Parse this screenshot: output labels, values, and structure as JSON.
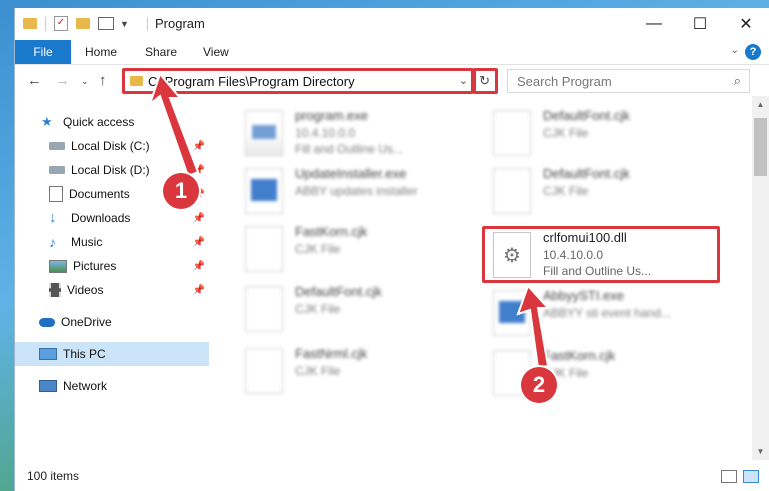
{
  "window": {
    "title": "Program",
    "controls": {
      "minimize": "—",
      "maximize": "☐",
      "close": "✕"
    }
  },
  "ribbon": {
    "file": "File",
    "tabs": [
      "Home",
      "Share",
      "View"
    ],
    "help": "?"
  },
  "nav": {
    "address": "C:\\Program Files\\Program Directory",
    "search_placeholder": "Search Program"
  },
  "sidebar": {
    "items": [
      {
        "label": "Quick access",
        "icon": "star-icon",
        "pinned": false
      },
      {
        "label": "Local Disk (C:)",
        "icon": "drive-icon",
        "pinned": true
      },
      {
        "label": "Local Disk (D:)",
        "icon": "drive-icon",
        "pinned": true
      },
      {
        "label": "Documents",
        "icon": "documents-icon",
        "pinned": true
      },
      {
        "label": "Downloads",
        "icon": "download-arrow-icon",
        "pinned": true
      },
      {
        "label": "Music",
        "icon": "music-note-icon",
        "pinned": true
      },
      {
        "label": "Pictures",
        "icon": "pictures-icon",
        "pinned": true
      },
      {
        "label": "Videos",
        "icon": "film-strip-icon",
        "pinned": true
      },
      {
        "label": "OneDrive",
        "icon": "cloud-icon",
        "pinned": false
      },
      {
        "label": "This PC",
        "icon": "monitor-icon",
        "pinned": false,
        "selected": true
      },
      {
        "label": "Network",
        "icon": "network-icon",
        "pinned": false
      }
    ]
  },
  "files": [
    {
      "name": "program.exe",
      "line1": "10.4.10.0.0",
      "line2": "Fill and Outline Us...",
      "icon": "installer-icon",
      "blurred": true
    },
    {
      "name": "DefaultFont.cjk",
      "line1": "CJK File",
      "line2": "",
      "icon": "blank-file-icon",
      "blurred": true
    },
    {
      "name": "UpdateInstaller.exe",
      "line1": "ABBY updates installer",
      "line2": "",
      "icon": "app-window-icon",
      "blurred": true
    },
    {
      "name": "DefaultFont.cjk",
      "line1": "CJK File",
      "line2": "",
      "icon": "blank-file-icon",
      "blurred": true
    },
    {
      "name": "FastKorn.cjk",
      "line1": "CJK File",
      "line2": "",
      "icon": "blank-file-icon",
      "blurred": true
    },
    {
      "name": "crlfomui100.dll",
      "line1": "10.4.10.0.0",
      "line2": "Fill and Outline Us...",
      "icon": "gear-file-icon",
      "blurred": false
    },
    {
      "name": "DefaultFont.cjk",
      "line1": "CJK File",
      "line2": "",
      "icon": "blank-file-icon",
      "blurred": true
    },
    {
      "name": "AbbyySTI.exe",
      "line1": "ABBYY sti event hand...",
      "line2": "",
      "icon": "app-window-icon",
      "blurred": true
    },
    {
      "name": "FastNrml.cjk",
      "line1": "CJK File",
      "line2": "",
      "icon": "blank-file-icon",
      "blurred": true
    },
    {
      "name": "FastKorn.cjk",
      "line1": "CJK File",
      "line2": "",
      "icon": "blank-file-icon",
      "blurred": true
    }
  ],
  "status": {
    "count": "100 items"
  },
  "annotations": {
    "step1": "1",
    "step2": "2",
    "color": "#d9363e"
  }
}
